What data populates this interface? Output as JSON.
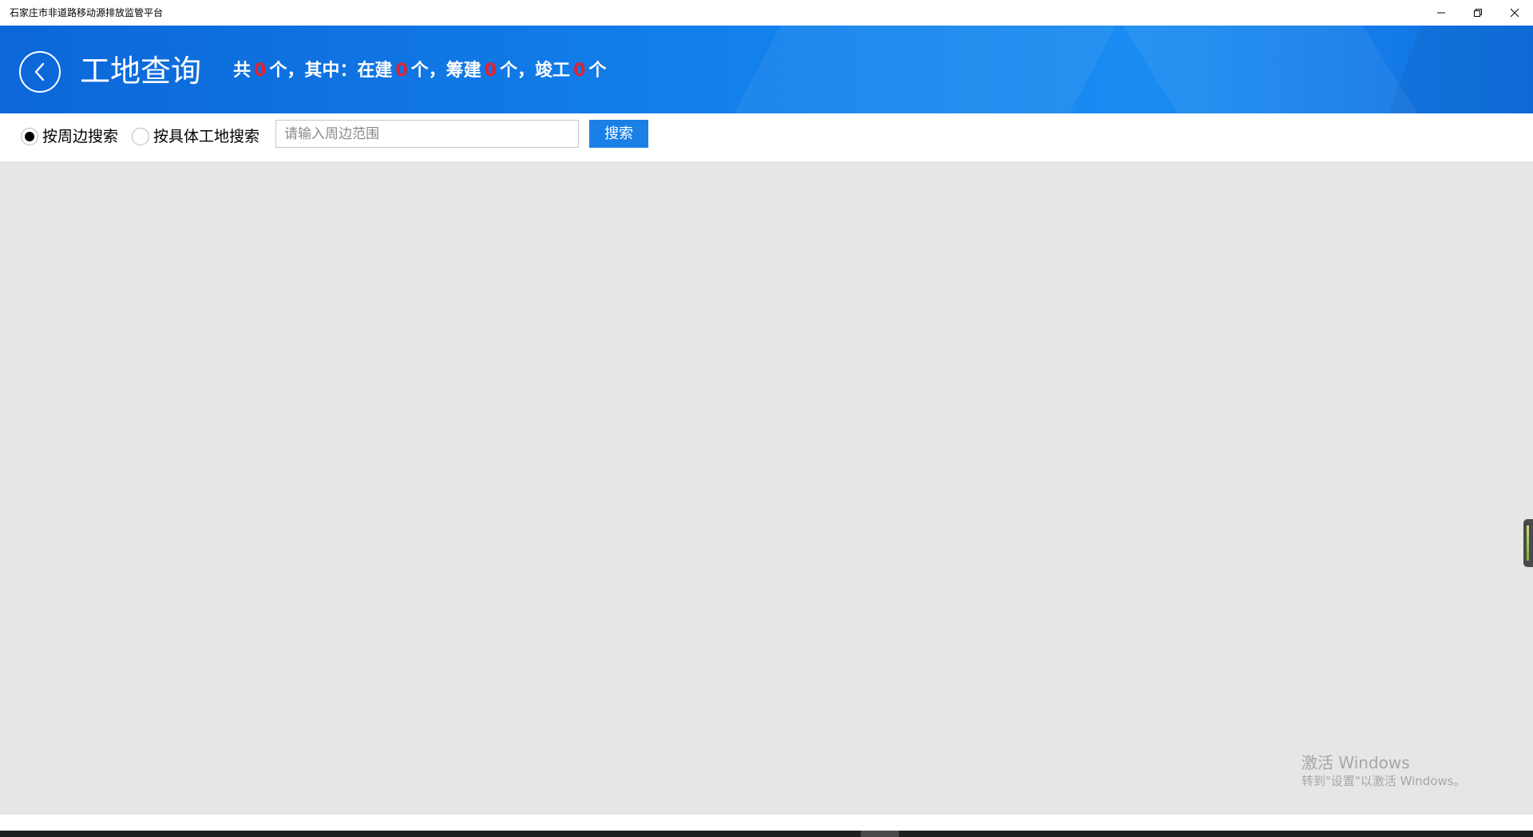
{
  "window": {
    "title": "石家庄市非道路移动源排放监管平台",
    "controls": {
      "minimize_icon": "minimize-icon",
      "restore_icon": "restore-icon",
      "close_icon": "close-icon"
    }
  },
  "header": {
    "back_icon": "chevron-left-icon",
    "title": "工地查询",
    "summary": {
      "total_prefix": "共",
      "total_value": "0",
      "total_suffix": "个，其中：在建",
      "building_value": "0",
      "building_suffix": "个，筹建",
      "planned_value": "0",
      "planned_suffix": "个，竣工",
      "completed_value": "0",
      "completed_suffix": "个"
    },
    "colors": {
      "background": "#127fea",
      "highlight_number": "#e8202a"
    }
  },
  "search": {
    "options": [
      {
        "label": "按周边搜索",
        "selected": true
      },
      {
        "label": "按具体工地搜索",
        "selected": false
      }
    ],
    "input": {
      "value": "",
      "placeholder": "请输入周边范围"
    },
    "button_label": "搜索",
    "button_color": "#1a80e6"
  },
  "watermark": {
    "title": "激活 Windows",
    "subtitle": "转到\"设置\"以激活 Windows。"
  }
}
